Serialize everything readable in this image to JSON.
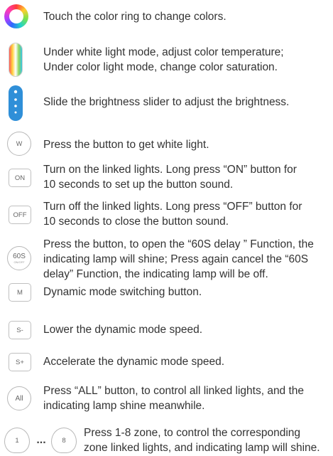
{
  "rows": [
    {
      "id": "color-ring",
      "lines": [
        "Touch the color ring to change colors."
      ]
    },
    {
      "id": "color-temp",
      "lines": [
        "Under white light mode, adjust color temperature;",
        "Under color light mode, change color saturation."
      ]
    },
    {
      "id": "brightness",
      "lines": [
        "Slide the brightness slider to adjust the brightness."
      ]
    },
    {
      "id": "white",
      "button": "W",
      "lines": [
        "Press the button to get white light."
      ]
    },
    {
      "id": "on",
      "button": "ON",
      "lines": [
        "Turn on the linked lights. Long press “ON” button for",
        "10 seconds to set up the button sound."
      ]
    },
    {
      "id": "off",
      "button": "OFF",
      "lines": [
        "Turn off the linked lights. Long press “OFF” button for",
        "10 seconds to close the button sound."
      ]
    },
    {
      "id": "delay",
      "button": "60S",
      "button_sub": "ON/OFF",
      "lines": [
        "Press the button, to open the “60S delay ” Function, the",
        "indicating lamp will shine; Press again cancel the “60S",
        "delay” Function, the indicating lamp will be off."
      ]
    },
    {
      "id": "mode",
      "button": "M",
      "lines": [
        "Dynamic mode switching button."
      ]
    },
    {
      "id": "speed-down",
      "button": "S-",
      "lines": [
        "Lower the dynamic mode speed."
      ]
    },
    {
      "id": "speed-up",
      "button": "S+",
      "lines": [
        "Accelerate the dynamic mode speed."
      ]
    },
    {
      "id": "all",
      "button": "All",
      "lines": [
        "Press “ALL” button, to control all linked lights, and the",
        "indicating lamp shine meanwhile."
      ]
    },
    {
      "id": "zones",
      "button_first": "1",
      "button_ellipsis": "...",
      "button_last": "8",
      "lines": [
        "Press 1-8 zone, to control the corresponding",
        "zone linked lights, and indicating lamp will shine."
      ]
    }
  ]
}
